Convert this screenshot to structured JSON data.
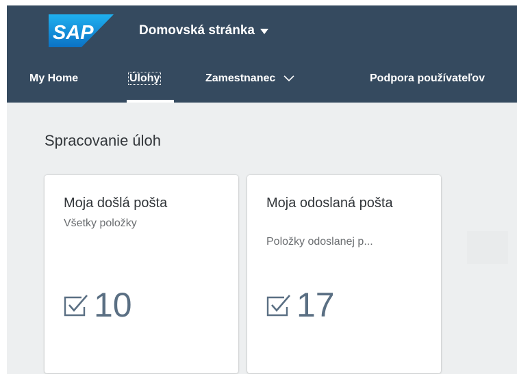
{
  "header": {
    "logo_text": "SAP",
    "home_title": "Domovská stránka",
    "tabs": [
      {
        "label": "My Home"
      },
      {
        "label": "Úlohy"
      },
      {
        "label": "Zamestnanec"
      },
      {
        "label": "Podpora používateľov"
      }
    ],
    "active_tab": "Úlohy"
  },
  "section": {
    "title": "Spracovanie úloh"
  },
  "tiles": [
    {
      "title": "Moja došlá pošta",
      "subtitle": "Všetky položky",
      "icon": "task-checkbox-icon",
      "value": "10"
    },
    {
      "title": "Moja odoslaná pošta",
      "subtitle": "Položky odoslanej p...",
      "icon": "task-checkbox-icon",
      "value": "17"
    }
  ],
  "colors": {
    "header_bg": "#354a5f",
    "page_bg": "#edeff0",
    "kpi_color": "#5a6f83",
    "sap_logo_blue": "#1aa4e8"
  }
}
